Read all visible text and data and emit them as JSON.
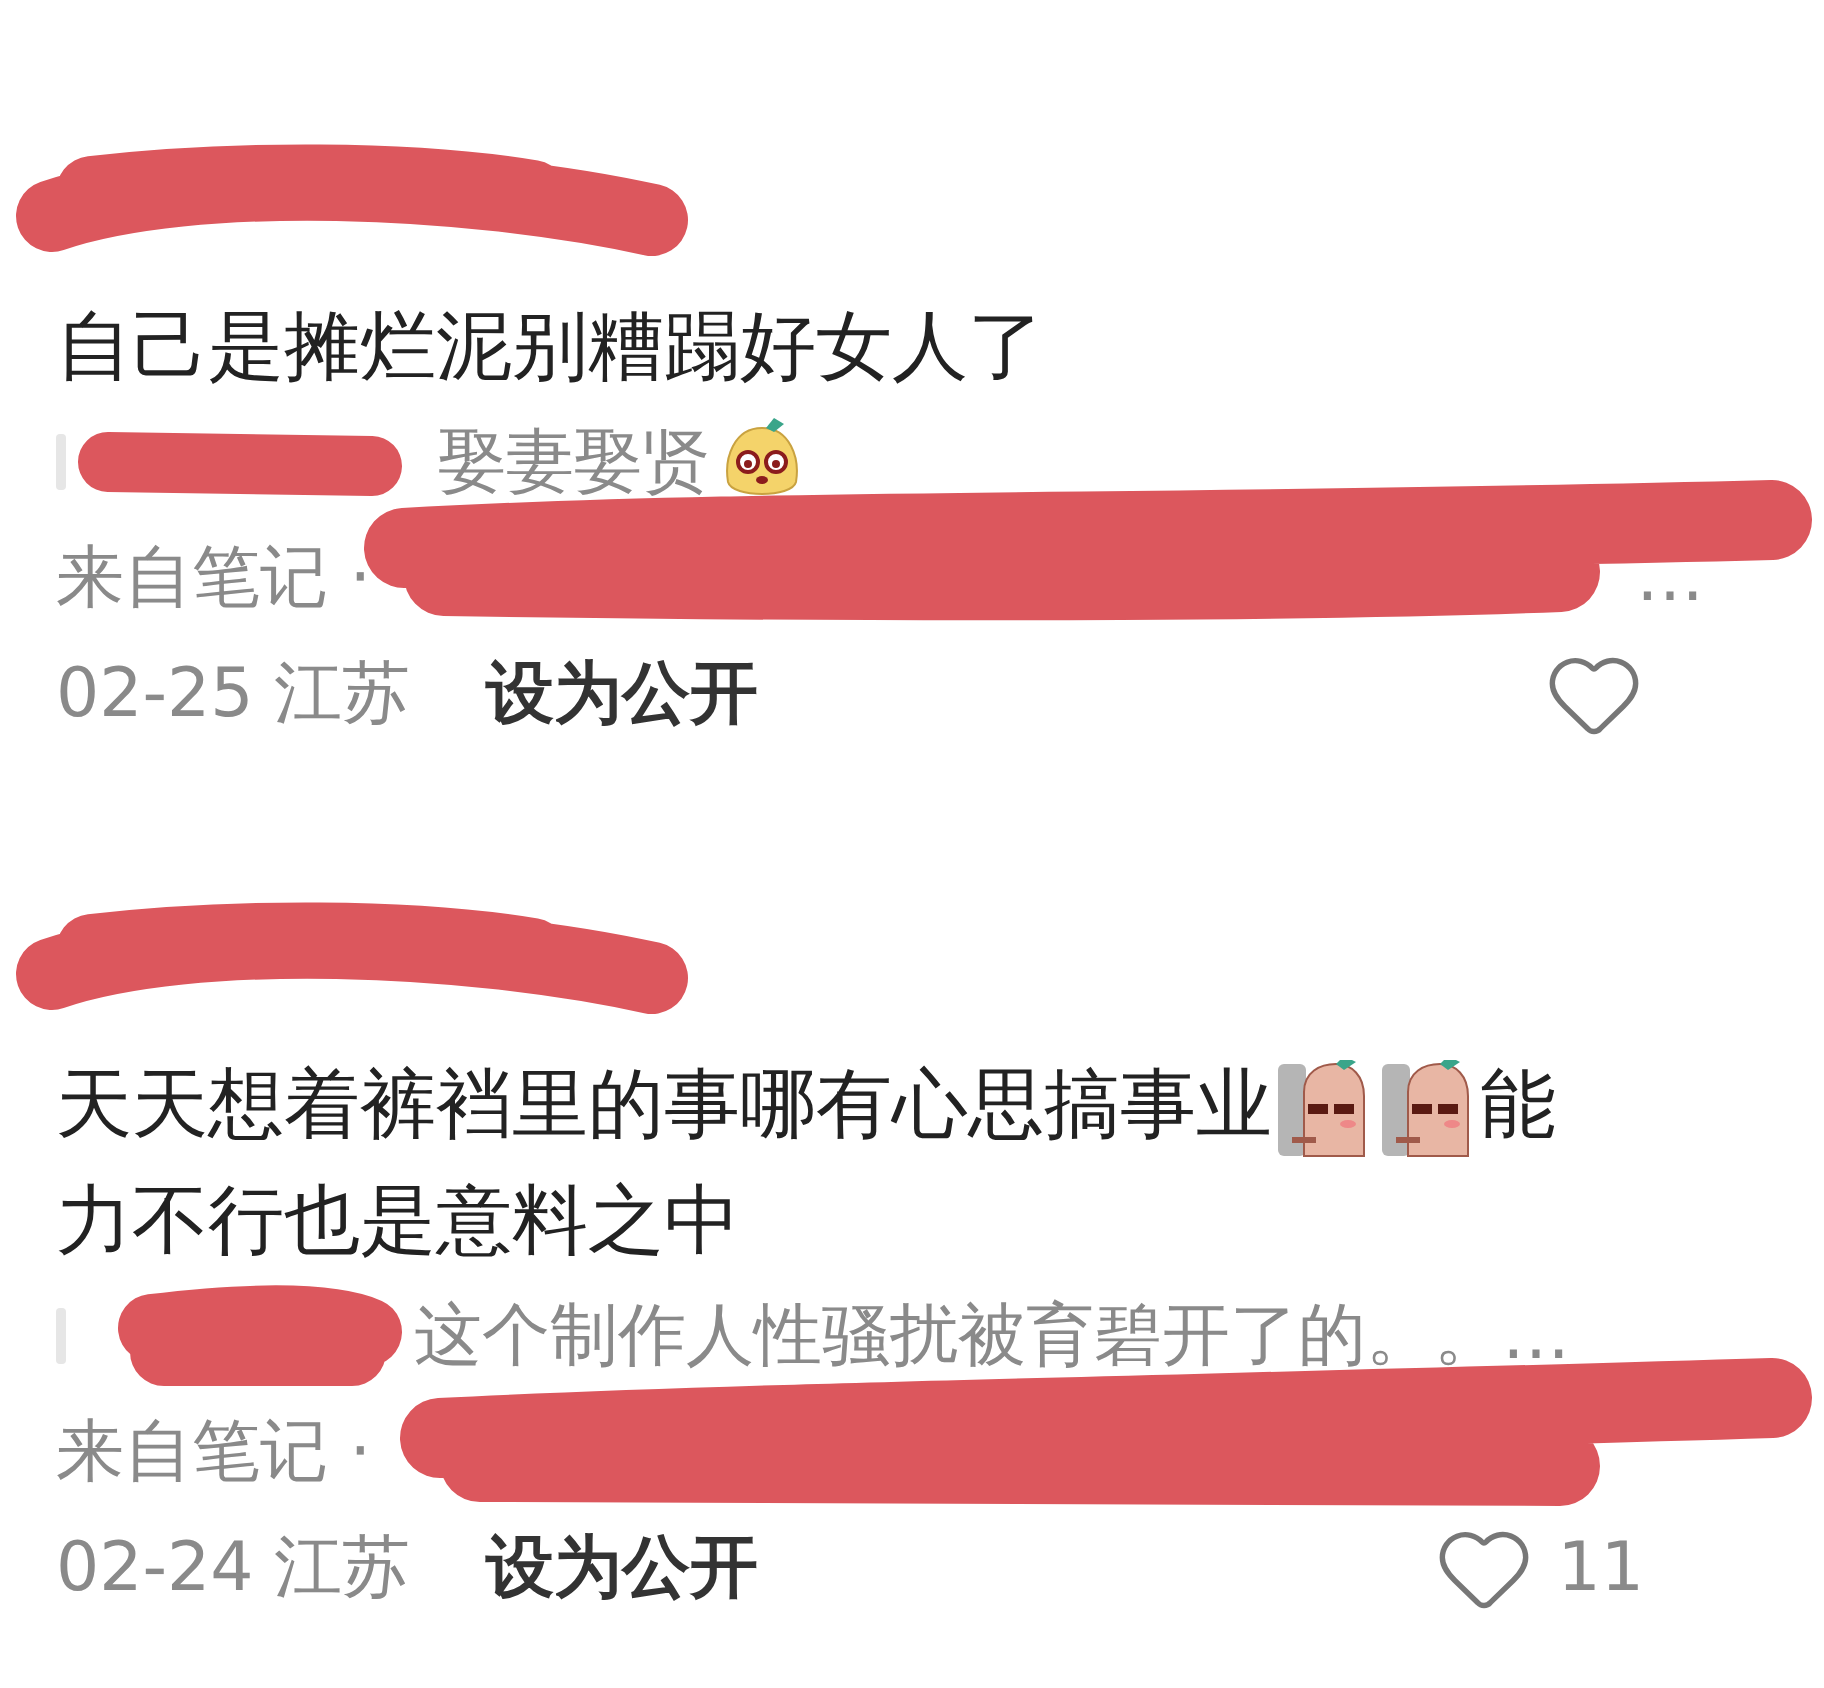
{
  "comments": [
    {
      "author_redacted": true,
      "body": [
        {
          "kind": "text",
          "text": "自己是摊烂泥别糟蹋好女人了"
        }
      ],
      "quote": {
        "author_redacted": true,
        "parts": [
          {
            "kind": "text",
            "text": "娶妻娶贤"
          },
          {
            "kind": "blob"
          }
        ]
      },
      "source": {
        "text": "来自笔记 ·",
        "redacted": true,
        "more": "…"
      },
      "meta": {
        "date": "02-25",
        "location": "江苏",
        "action": "设为公开",
        "liked": false
      }
    },
    {
      "author_redacted": true,
      "body": [
        {
          "kind": "text",
          "text": "天天想着裤裆里的事哪有心思搞事业"
        },
        {
          "kind": "wall"
        },
        {
          "kind": "wall"
        },
        {
          "kind": "text",
          "text": "能"
        },
        {
          "kind": "text",
          "text": "力不行也是意料之中"
        }
      ],
      "quote": {
        "author_redacted": true,
        "parts": [
          {
            "kind": "text",
            "text": "这个制作人性骚扰被育碧开了的。。…"
          }
        ]
      },
      "source": {
        "text": "来自笔记 ·",
        "redacted": true
      },
      "meta": {
        "date": "02-24",
        "location": "江苏",
        "action": "设为公开",
        "liked": false,
        "likes": "11"
      }
    }
  ]
}
